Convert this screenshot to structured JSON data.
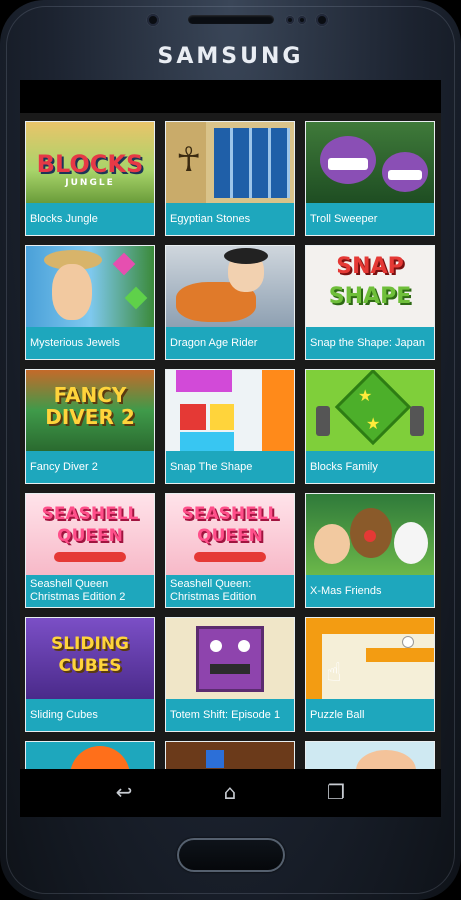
{
  "device": {
    "brand": "SAMSUNG"
  },
  "games": [
    {
      "title": "Blocks Jungle",
      "art": "BLOCKS",
      "art_sub": "JUNGLE"
    },
    {
      "title": "Egyptian Stones",
      "art": ""
    },
    {
      "title": "Troll Sweeper",
      "art": ""
    },
    {
      "title": "Mysterious Jewels",
      "art": ""
    },
    {
      "title": "Dragon Age Rider",
      "art": ""
    },
    {
      "title": "Snap the Shape: Japan",
      "art": "SNAP",
      "art_sub": "SHAPE"
    },
    {
      "title": "Fancy Diver 2",
      "art": "FANCY DIVER 2"
    },
    {
      "title": "Snap The Shape",
      "art": ""
    },
    {
      "title": "Blocks Family",
      "art": ""
    },
    {
      "title": "Seashell Queen Christmas Edition 2",
      "art": "SEASHELL",
      "art_sub": "QUEEN"
    },
    {
      "title": "Seashell Queen: Christmas Edition",
      "art": "SEASHELL",
      "art_sub": "QUEEN"
    },
    {
      "title": "X-Mas Friends",
      "art": ""
    },
    {
      "title": "Sliding Cubes",
      "art": "SLIDING",
      "art_sub": "CUBES"
    },
    {
      "title": "Totem Shift: Episode 1",
      "art": ""
    },
    {
      "title": "Puzzle Ball",
      "art": ""
    }
  ],
  "nav": {
    "back_icon": "back-icon",
    "home_icon": "home-icon",
    "recents_icon": "recents-icon"
  }
}
